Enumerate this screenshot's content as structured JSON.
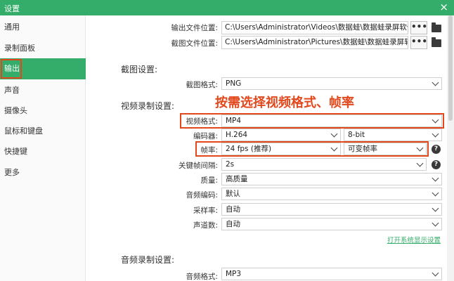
{
  "window": {
    "title": "设置",
    "close_icon": "×"
  },
  "sidebar": {
    "items": [
      {
        "label": "通用",
        "active": false
      },
      {
        "label": "录制面板",
        "active": false
      },
      {
        "label": "输出",
        "active": true
      },
      {
        "label": "声音",
        "active": false
      },
      {
        "label": "摄像头",
        "active": false
      },
      {
        "label": "鼠标和键盘",
        "active": false
      },
      {
        "label": "快捷键",
        "active": false
      },
      {
        "label": "更多",
        "active": false
      }
    ]
  },
  "output": {
    "video_path_label": "输出文件位置:",
    "video_path": "C:\\Users\\Administrator\\Videos\\数据蛙\\数据蛙录屏软件",
    "pic_path_label": "截图文件位置:",
    "pic_path": "C:\\Users\\Administrator\\Pictures\\数据蛙\\数据蛙录屏软件",
    "browse_label": "•••"
  },
  "screenshot": {
    "section_title": "截图设置:",
    "format_label": "截图格式:",
    "format_value": "PNG"
  },
  "video": {
    "section_title": "视频录制设置:",
    "annotation": "按需选择视频格式、帧率",
    "format_label": "视频格式:",
    "format_value": "MP4",
    "encoder_label": "编码器:",
    "encoder_value": "H.264",
    "bitdepth_value": "8-bit",
    "fps_label": "帧率:",
    "fps_value": "24 fps (推荐)",
    "fps_mode_value": "可变帧率",
    "keyframe_label": "关键帧间隔:",
    "keyframe_value": "2s",
    "quality_label": "质量:",
    "quality_value": "高质量",
    "audio_codec_label": "音频编码:",
    "audio_codec_value": "默认",
    "sample_rate_label": "采样率:",
    "sample_rate_value": "自动",
    "channels_label": "声道数:",
    "channels_value": "自动",
    "display_settings_link": "打开系统显示设置"
  },
  "audio": {
    "section_title": "音频录制设置:",
    "format_label": "音频格式:",
    "format_value": "MP3"
  },
  "help_icon": "?",
  "colors": {
    "accent": "#35ad6a",
    "annotation": "#e2481c"
  }
}
